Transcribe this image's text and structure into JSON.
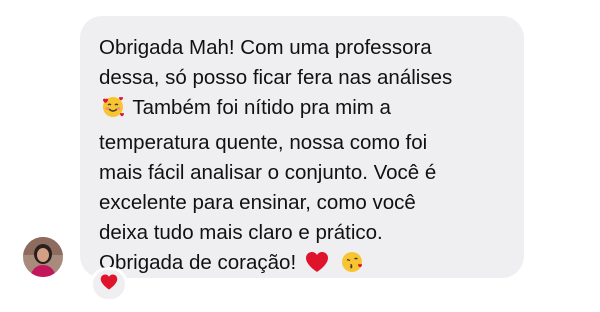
{
  "message": {
    "lines": [
      "Obrigada Mah! Com uma professora",
      "dessa, só posso ficar fera nas análises",
      "Também foi nítido pra mim a",
      "temperatura quente, nossa como foi",
      "mais fácil analisar o conjunto. Você é",
      "excelente para ensinar, como você",
      "deixa tudo mais claro e prático.",
      "Obrigada de coração!"
    ],
    "emojis": [
      "smiling-face-with-hearts",
      "red-heart",
      "face-blowing-kiss"
    ]
  },
  "reaction": {
    "emoji": "red-heart"
  },
  "colors": {
    "bubble": "#efeff1",
    "text": "#111111",
    "heart": "#e0132c",
    "emoji_face": "#f7c532",
    "avatar_bg": "#9b7b6d",
    "avatar_shirt": "#c2185b"
  }
}
